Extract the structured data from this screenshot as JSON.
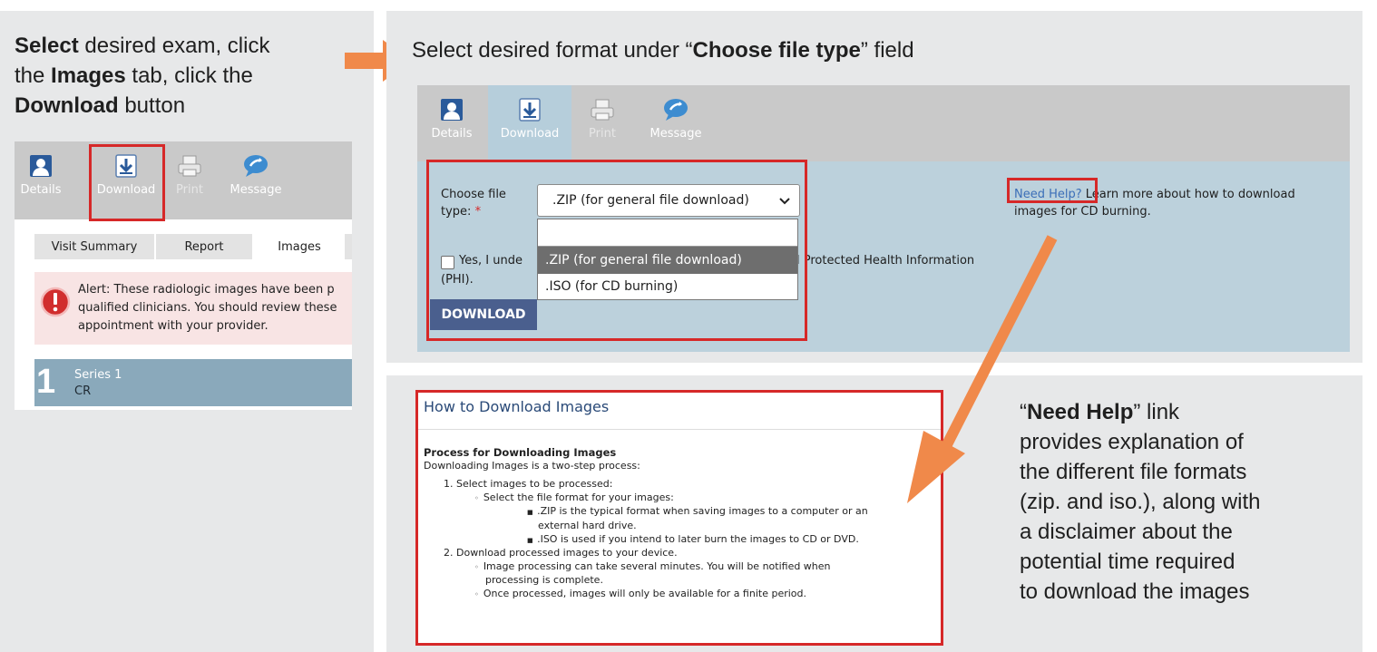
{
  "left_panel": {
    "instruction": {
      "line1_bold": "Select",
      "line1_rest": " desired exam, click",
      "line2_pre": "the ",
      "line2_bold": "Images",
      "line2_post": " tab,  click the",
      "line3_bold": "Download",
      "line3_rest": " button"
    },
    "toolbar": {
      "items": [
        {
          "label": "Details"
        },
        {
          "label": "Download"
        },
        {
          "label": "Print"
        },
        {
          "label": "Message"
        }
      ]
    },
    "tabs": [
      {
        "label": "Visit Summary"
      },
      {
        "label": "Report"
      },
      {
        "label": "Images"
      }
    ],
    "alert": {
      "line1": "Alert: These radiologic images have been p",
      "line2": "qualified clinicians. You should review these",
      "line3": "appointment with your provider."
    },
    "series": {
      "number": "1",
      "name": "Series 1",
      "modality": "CR"
    }
  },
  "right_top_panel": {
    "heading": {
      "pre": "Select desired format under “",
      "bold": "Choose file type",
      "post": "” field"
    },
    "toolbar": {
      "items": [
        {
          "label": "Details"
        },
        {
          "label": "Download"
        },
        {
          "label": "Print"
        },
        {
          "label": "Message"
        }
      ]
    },
    "form": {
      "file_type_label_line1": "Choose file",
      "file_type_label_line2": "type:",
      "required_mark": "*",
      "select_value": ".ZIP (for general file download)",
      "dropdown_options": [
        "",
        ".ZIP (for general file download)",
        ".ISO (for CD burning)"
      ],
      "checkbox_text_start": "Yes, I unde",
      "checkbox_text_end": "l Protected Health Information",
      "checkbox_text_line2": "(PHI).",
      "download_button": "DOWNLOAD"
    },
    "help": {
      "link": "Need Help?",
      "text_line1": " Learn more about how to download",
      "text_line2": "images for CD burning."
    }
  },
  "bottom_right": {
    "help_box": {
      "title": "How to Download Images",
      "section_title": "Process for Downloading Images",
      "intro": "Downloading Images is a two-step process:",
      "step1": "1. Select images to be processed:",
      "step1_sub": "Select the file format for your images:",
      "zip_line1": ".ZIP is the typical format when saving images to a computer or an",
      "zip_line2": "external hard drive.",
      "iso_line": ".ISO is used if you intend to later burn the images to CD or DVD.",
      "step2": "2. Download processed images to your device.",
      "step2_sub1_line1": "Image processing can take several minutes. You will be notified when",
      "step2_sub1_line2": "processing is complete.",
      "step2_sub2": "Once processed, images will only be available for a finite period."
    },
    "explanation": {
      "open_quote": "“",
      "bold": "Need Help",
      "line1_rest": "” link",
      "line2": "provides explanation of",
      "line3": "the different file formats",
      "line4": "(zip. and iso.), along with",
      "line5": "a disclaimer about the",
      "line6": "potential time required",
      "line7": "to download the images"
    }
  },
  "colors": {
    "panel_bg": "#e7e8e9",
    "toolbar_bg": "#c9c9c9",
    "form_bg": "#bcd1dc",
    "highlight_red": "#d62828",
    "arrow_orange": "#f0894a",
    "button_blue": "#4a5f8e",
    "series_blue": "#8aa9bb",
    "alert_bg": "#f8e4e4"
  },
  "icons": [
    "person-icon",
    "download-icon",
    "printer-icon",
    "message-bubble-icon",
    "alert-icon",
    "chevron-down-icon",
    "orange-arrow-icon"
  ]
}
